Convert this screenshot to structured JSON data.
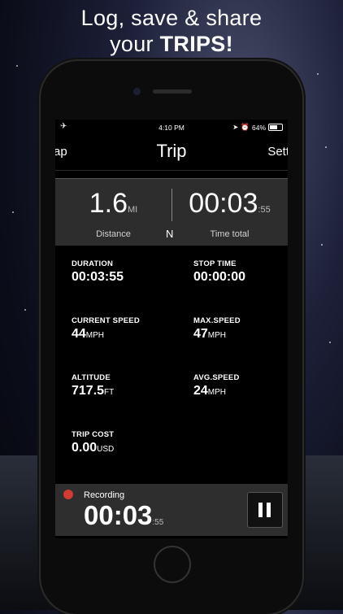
{
  "headline": {
    "line1": "Log, save & share",
    "line2_prefix": "your ",
    "line2_bold": "TRIPS!"
  },
  "status_bar": {
    "time": "4:10 PM",
    "battery": "64%",
    "airplane_icon": "airplane-icon",
    "location_icon": "location-arrow-icon",
    "alarm_icon": "alarm-icon"
  },
  "nav": {
    "title": "Trip",
    "left": "ap",
    "right": "Sett"
  },
  "panel": {
    "distance_value": "1.6",
    "distance_unit": "MI",
    "distance_label": "Distance",
    "time_value": "00:03",
    "time_seconds": ":55",
    "time_label": "Time total",
    "compass": "N"
  },
  "stats": {
    "duration": {
      "label": "DURATION",
      "value": "00:03:55",
      "unit": ""
    },
    "stop_time": {
      "label": "STOP TIME",
      "value": "00:00:00",
      "unit": ""
    },
    "current_speed": {
      "label": "CURRENT SPEED",
      "value": "44",
      "unit": "MPH"
    },
    "max_speed": {
      "label": "MAX.SPEED",
      "value": "47",
      "unit": "MPH"
    },
    "altitude": {
      "label": "ALTITUDE",
      "value": "717.5",
      "unit": "FT"
    },
    "avg_speed": {
      "label": "AVG.SPEED",
      "value": "24",
      "unit": "MPH"
    },
    "trip_cost": {
      "label": "TRIP COST",
      "value": "0.00",
      "unit": "USD"
    }
  },
  "recording": {
    "label": "Recording",
    "time": "00:03",
    "seconds": ":55"
  },
  "colors": {
    "record_dot": "#d23b32",
    "panel_bg": "#2d2d2d"
  }
}
